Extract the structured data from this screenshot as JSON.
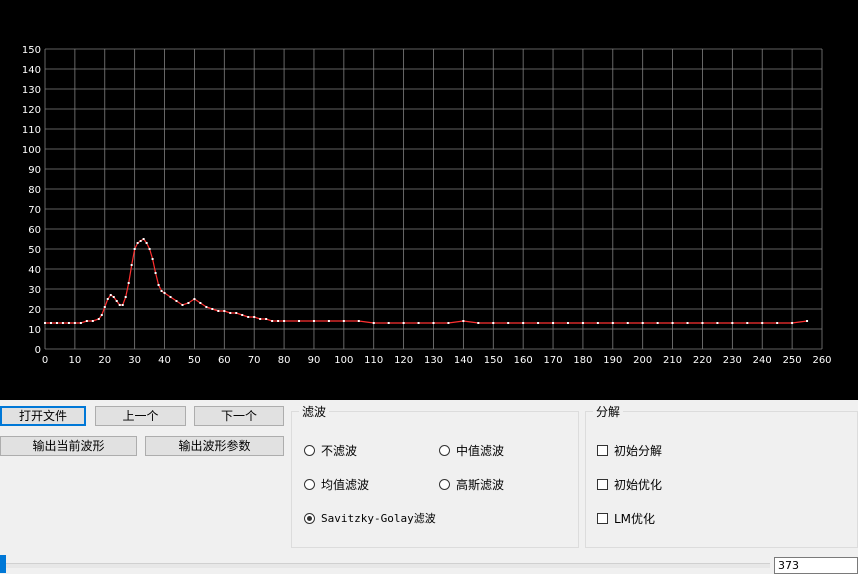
{
  "toolbar": {
    "open_file": "打开文件",
    "prev": "上一个",
    "next": "下一个",
    "export_waveform": "输出当前波形",
    "export_params": "输出波形参数"
  },
  "filter_group": {
    "title": "滤波",
    "options": [
      "不滤波",
      "中值滤波",
      "均值滤波",
      "高斯滤波",
      "Savitzky-Golay滤波"
    ],
    "selected": "Savitzky-Golay滤波"
  },
  "decomp_group": {
    "title": "分解",
    "options": [
      "初始分解",
      "初始优化",
      "LM优化"
    ],
    "checked": [
      false,
      false,
      false
    ]
  },
  "frame_index": "373",
  "slider": {
    "value_fraction": 0.0
  },
  "colors": {
    "plot_bg": "#000000",
    "grid": "#808080",
    "series": "#ff3030",
    "markers": "#ffffff",
    "accent": "#0078d7"
  },
  "chart_data": {
    "type": "line",
    "xlim": [
      0,
      260
    ],
    "ylim": [
      0,
      150
    ],
    "xticks": [
      0,
      10,
      20,
      30,
      40,
      50,
      60,
      70,
      80,
      90,
      100,
      110,
      120,
      130,
      140,
      150,
      160,
      170,
      180,
      190,
      200,
      210,
      220,
      230,
      240,
      250,
      260
    ],
    "yticks": [
      0,
      10,
      20,
      30,
      40,
      50,
      60,
      70,
      80,
      90,
      100,
      110,
      120,
      130,
      140,
      150
    ],
    "grid": true,
    "series": [
      {
        "x": [
          0,
          2,
          4,
          6,
          8,
          10,
          12,
          14,
          16,
          18,
          19,
          20,
          21,
          22,
          23,
          24,
          25,
          26,
          27,
          28,
          29,
          30,
          31,
          32,
          33,
          34,
          35,
          36,
          37,
          38,
          39,
          40,
          42,
          44,
          46,
          48,
          50,
          52,
          54,
          56,
          58,
          60,
          62,
          64,
          66,
          68,
          70,
          72,
          74,
          76,
          78,
          80,
          85,
          90,
          95,
          100,
          105,
          110,
          115,
          120,
          125,
          130,
          135,
          140,
          145,
          150,
          155,
          160,
          165,
          170,
          175,
          180,
          185,
          190,
          195,
          200,
          205,
          210,
          215,
          220,
          225,
          230,
          235,
          240,
          245,
          250,
          255
        ],
        "y": [
          13,
          13,
          13,
          13,
          13,
          13,
          13,
          14,
          14,
          15,
          17,
          21,
          25,
          27,
          26,
          24,
          22,
          22,
          26,
          33,
          42,
          50,
          53,
          54,
          55,
          53,
          50,
          45,
          38,
          32,
          29,
          28,
          26,
          24,
          22,
          23,
          25,
          23,
          21,
          20,
          19,
          19,
          18,
          18,
          17,
          16,
          16,
          15,
          15,
          14,
          14,
          14,
          14,
          14,
          14,
          14,
          14,
          13,
          13,
          13,
          13,
          13,
          13,
          14,
          13,
          13,
          13,
          13,
          13,
          13,
          13,
          13,
          13,
          13,
          13,
          13,
          13,
          13,
          13,
          13,
          13,
          13,
          13,
          13,
          13,
          13,
          14
        ]
      }
    ]
  }
}
